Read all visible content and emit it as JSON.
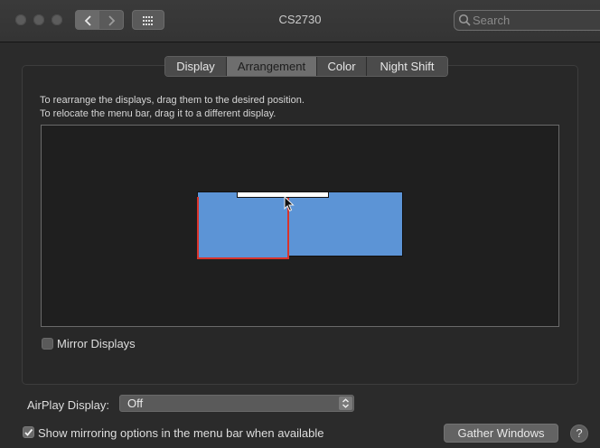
{
  "window": {
    "title": "CS2730"
  },
  "search": {
    "placeholder": "Search"
  },
  "tabs": [
    {
      "label": "Display",
      "active": false
    },
    {
      "label": "Arrangement",
      "active": true
    },
    {
      "label": "Color",
      "active": false
    },
    {
      "label": "Night Shift",
      "active": false
    }
  ],
  "arrangement": {
    "instruction_1": "To rearrange the displays, drag them to the desired position.",
    "instruction_2": "To relocate the menu bar, drag it to a different display.",
    "mirror_label": "Mirror Displays",
    "mirror_checked": false
  },
  "airplay": {
    "label": "AirPlay Display:",
    "value": "Off"
  },
  "footer": {
    "show_mirroring_label": "Show mirroring options in the menu bar when available",
    "show_mirroring_checked": true,
    "gather_button": "Gather Windows",
    "help_button": "?"
  },
  "colors": {
    "display_fill": "#5c94d6",
    "main_display_border": "#d8332b",
    "menubar": "#ffffff"
  },
  "icons": {
    "back": "chevron-left-icon",
    "forward": "chevron-right-icon",
    "grid": "grid-icon",
    "search": "search-icon",
    "cursor": "cursor-icon",
    "checkmark": "checkmark-icon",
    "updown": "updown-arrows-icon"
  }
}
